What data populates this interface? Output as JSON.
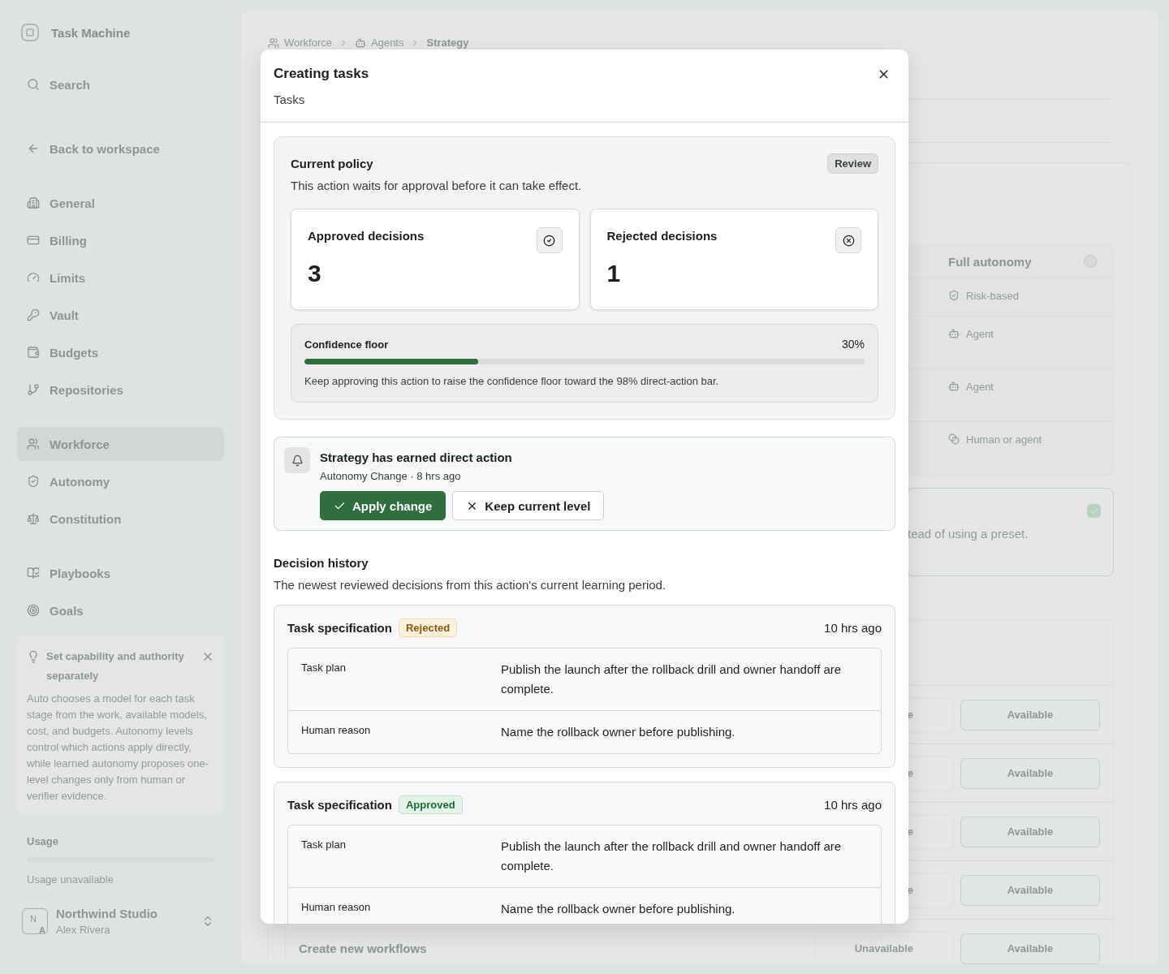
{
  "sidebar": {
    "app_name": "Task Machine",
    "search": "Search",
    "back": "Back to workspace",
    "groups": [
      [
        {
          "label": "General",
          "selected": false
        },
        {
          "label": "Billing",
          "selected": false
        },
        {
          "label": "Limits",
          "selected": false
        },
        {
          "label": "Vault",
          "selected": false
        },
        {
          "label": "Budgets",
          "selected": false
        },
        {
          "label": "Repositories",
          "selected": false
        }
      ],
      [
        {
          "label": "Workforce",
          "selected": true
        },
        {
          "label": "Autonomy",
          "selected": false
        },
        {
          "label": "Constitution",
          "selected": false
        }
      ],
      [
        {
          "label": "Playbooks",
          "selected": false
        },
        {
          "label": "Goals",
          "selected": false
        }
      ]
    ],
    "tip": {
      "title": "Set capability and authority separately",
      "body": "Auto chooses a model for each task stage from the work, available models, cost, and budgets. Autonomy levels control which actions apply directly, while learned autonomy proposes one-level changes only from human or verifier evidence."
    },
    "usage": {
      "label": "Usage",
      "level": 0,
      "status": "Usage unavailable"
    },
    "account": {
      "initials": [
        "N",
        "A"
      ],
      "name": "Northwind Studio",
      "user": "Alex Rivera"
    }
  },
  "breadcrumb": [
    "Workforce",
    "Agents",
    "Strategy"
  ],
  "autonomy_table": {
    "header": "Full autonomy",
    "rows": [
      "Risk-based",
      "Agent",
      "Agent",
      "Human or agent"
    ]
  },
  "preset_option": {
    "text": "tead of using a preset.",
    "checked": true
  },
  "capability_rows": [
    {
      "column_2": "e",
      "column_3": "Available"
    },
    {
      "column_2": "e",
      "column_3": "Available"
    },
    {
      "column_2": "e",
      "column_3": "Available"
    },
    {
      "column_2": "e",
      "column_3": "Available"
    },
    {
      "label": "Create new workflows",
      "column_2": "Unavailable",
      "column_3": "Available"
    }
  ],
  "dialog": {
    "title": "Creating tasks",
    "subtitle": "Tasks",
    "policy": {
      "title": "Current policy",
      "badge": "Review",
      "description": "This action waits for approval before it can take effect.",
      "stats": [
        {
          "label": "Approved decisions",
          "value": "3",
          "kind": "approved"
        },
        {
          "label": "Rejected decisions",
          "value": "1",
          "kind": "rejected"
        }
      ],
      "confidence": {
        "label": "Confidence floor",
        "reading": "30%",
        "level": 0.31,
        "note": "Keep approving this action to raise the confidence floor toward the 98% direct-action bar."
      }
    },
    "notification": {
      "title": "Strategy has earned direct action",
      "meta": "Autonomy Change · 8 hrs ago",
      "actions": [
        {
          "label": "Apply change",
          "kind": "primary"
        },
        {
          "label": "Keep current level",
          "kind": "secondary"
        }
      ]
    },
    "history": {
      "title": "Decision history",
      "description": "The newest reviewed decisions from this action's current learning period.",
      "decisions": [
        {
          "title": "Task specification",
          "status": "Rejected",
          "kind": "rejected",
          "time": "10 hrs ago",
          "fields": [
            {
              "label": "Task plan",
              "value": "Publish the launch after the rollback drill and owner handoff are complete."
            },
            {
              "label": "Human reason",
              "value": "Name the rollback owner before publishing."
            }
          ]
        },
        {
          "title": "Task specification",
          "status": "Approved",
          "kind": "approved",
          "time": "10 hrs ago",
          "fields": [
            {
              "label": "Task plan",
              "value": "Publish the launch after the rollback drill and owner handoff are complete."
            },
            {
              "label": "Human reason",
              "value": "Name the rollback owner before publishing."
            }
          ]
        }
      ]
    }
  }
}
